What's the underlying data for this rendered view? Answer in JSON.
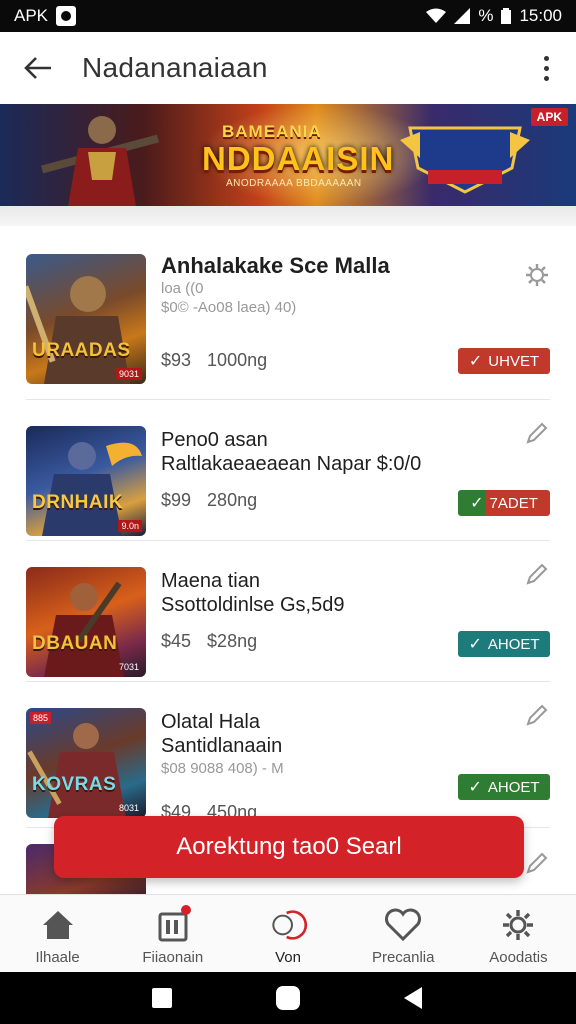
{
  "status_bar": {
    "left_text": "APK",
    "battery": "%",
    "time": "15:00"
  },
  "app_bar": {
    "title": "Nadananaiaan"
  },
  "banner": {
    "line1": "BAMEANIA",
    "line2": "NDDAAISIN",
    "line3": "ANODRAAAA BBDAAAAAN",
    "badge": "APK"
  },
  "items": [
    {
      "name": "Anhalakake Sce Malla",
      "meta1": "loa ((0",
      "meta2": "$0© -Ao08 laea)  40)",
      "price": "$93",
      "count": "1000ng",
      "status": "UHVET",
      "status_color": "#c0392b",
      "thumb_label": "URAADAS",
      "thumb_badge": "9031",
      "icon": "gear-icon"
    },
    {
      "name": "Peno0 asan",
      "sub": "Raltlakaeaeaean Napar $:0/0",
      "price": "$99",
      "count": "280ng",
      "status": "7ADET",
      "status_color": "#2e7d32",
      "status_color2": "#c0392b",
      "thumb_label": "DRNHAIK",
      "thumb_badge": "9.0n",
      "icon": "pencil-icon"
    },
    {
      "name": "Maena tian",
      "sub": "Ssottoldinlse Gs,5d9",
      "price": "$45",
      "count": "$28ng",
      "status": "AHOET",
      "status_color": "#1e7b7b",
      "thumb_label": "DBAUAN",
      "thumb_badge": "7031",
      "icon": "pencil-icon"
    },
    {
      "name": "Olatal Hala",
      "sub": "Santidlanaain",
      "meta2": "$08 9088  408) - M",
      "price": "$49",
      "count": "450ng",
      "status": "AHOET",
      "status_color": "#2e7d32",
      "thumb_label": "KOVRAS",
      "thumb_badge": "8031",
      "thumb_tag": "885",
      "icon": "pencil-icon"
    }
  ],
  "fab_label": "Aorektung tao0 Searl",
  "bottom_nav": [
    {
      "label": "Ilhaale",
      "icon": "home-icon"
    },
    {
      "label": "Fiiaonain",
      "icon": "store-icon"
    },
    {
      "label": "Von",
      "icon": "ring-icon"
    },
    {
      "label": "Precanlia",
      "icon": "heart-icon"
    },
    {
      "label": "Aoodatis",
      "icon": "settings-icon"
    }
  ],
  "colors": {
    "accent": "#d42328",
    "green": "#2e7d32",
    "teal": "#1e7b7b",
    "red": "#c0392b"
  }
}
